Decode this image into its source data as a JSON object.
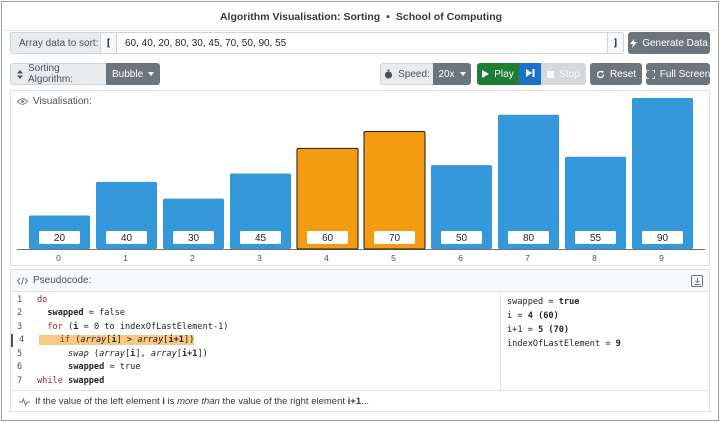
{
  "title": {
    "part1": "Algorithm Visualisation: Sorting",
    "separator": "•",
    "part2": "School of Computing"
  },
  "input": {
    "label": "Array data to sort:",
    "bracket_open": "[",
    "bracket_close": "]",
    "value": "60, 40, 20, 80, 30, 45, 70, 50, 90, 55",
    "generate_label": "Generate Data"
  },
  "controls": {
    "algorithm_label": "Sorting Algorithm:",
    "algorithm_value": "Bubble",
    "speed_label": "Speed:",
    "speed_value": "20x",
    "play_label": "Play",
    "stop_label": "Stop",
    "reset_label": "Reset",
    "fullscreen_label": "Full Screen"
  },
  "visualisation": {
    "label": "Visualisation:",
    "highlight_color": "#f39c12",
    "bar_color": "#3498db"
  },
  "chart_data": {
    "type": "bar",
    "categories": [
      "0",
      "1",
      "2",
      "3",
      "4",
      "5",
      "6",
      "7",
      "8",
      "9"
    ],
    "values": [
      20,
      40,
      30,
      45,
      60,
      70,
      50,
      80,
      55,
      90
    ],
    "highlighted": [
      4,
      5
    ],
    "ylim": [
      0,
      90
    ]
  },
  "pseudocode": {
    "label": "Pseudocode:",
    "lines": [
      {
        "num": "1"
      },
      {
        "num": "2"
      },
      {
        "num": "3"
      },
      {
        "num": "4"
      },
      {
        "num": "5"
      },
      {
        "num": "6"
      },
      {
        "num": "7"
      }
    ],
    "code": {
      "do": "do",
      "swapped": "swapped",
      "eq_false": " = false",
      "for": "for",
      "loop_var": "i",
      "for_rest": " = 0 to indexOfLastElement-1)",
      "if": "if",
      "array_a": "array",
      "gt": " > ",
      "array_b": "array",
      "idx_i": "i",
      "idx_i1": "i+1",
      "swap": "swap",
      "eq_true": " = true",
      "while": "while"
    },
    "variables": [
      {
        "name": "swapped",
        "op": " = ",
        "value": "true"
      },
      {
        "name": "i",
        "op": " = ",
        "value": "4 (60)"
      },
      {
        "name": "i+1",
        "op": " = ",
        "value": "5 (70)"
      },
      {
        "name": "indexOfLastElement",
        "op": " = ",
        "value": "9"
      }
    ],
    "explanation": {
      "prefix": "If the value of the left element ",
      "var1": "i",
      "mid1": " is ",
      "emph": "more than",
      "mid2": " the value of the right element ",
      "var2": "i+1",
      "suffix": "..."
    }
  }
}
